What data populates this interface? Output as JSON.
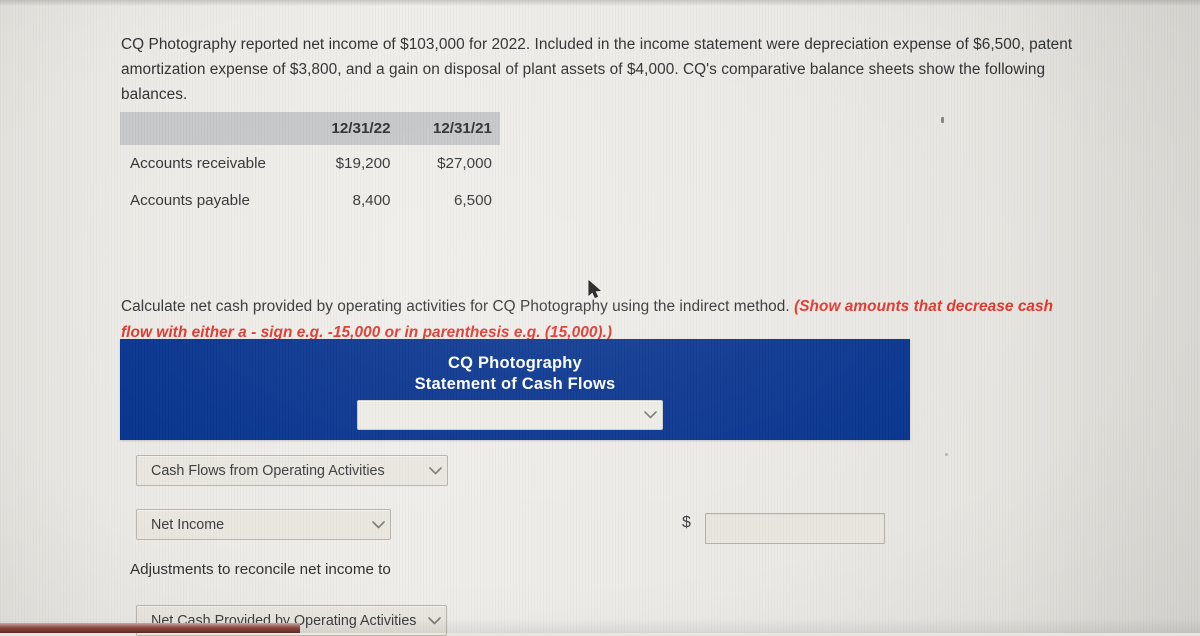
{
  "problem": {
    "intro_text": "CQ Photography reported net income of $103,000 for 2022. Included in the income statement were depreciation expense of $6,500, patent amortization expense of $3,800, and a gain on disposal of plant assets of $4,000. CQ's comparative balance sheets show the following balances.",
    "instruction_text": "Calculate net cash provided by operating activities for CQ Photography using the indirect method. ",
    "instruction_emphasis": "(Show amounts that decrease cash flow with either a - sign e.g. -15,000 or in parenthesis e.g. (15,000).)"
  },
  "balances_table": {
    "columns": [
      "",
      "12/31/22",
      "12/31/21"
    ],
    "rows": [
      {
        "label": "Accounts receivable",
        "col_2022": "$19,200",
        "col_2021": "$27,000"
      },
      {
        "label": "Accounts payable",
        "col_2022": "8,400",
        "col_2021": "6,500"
      }
    ]
  },
  "statement": {
    "company_name": "CQ Photography",
    "title": "Statement of Cash Flows",
    "period_select_value": "",
    "period_select_placeholder": ""
  },
  "form": {
    "section_select_value": "Cash Flows from Operating Activities",
    "line_1_select_value": "Net Income",
    "adjustments_label": "Adjustments to reconcile net income to",
    "line_2_select_value": "Net Cash Provided by Operating Activities",
    "currency_symbol": "$",
    "amount_value": "",
    "amount_placeholder": ""
  },
  "colors": {
    "statement_header_blue": "#04318d",
    "emphasis_red": "#e03228",
    "table_header_gray": "#c5c6c8",
    "page_background": "#ebe9e4"
  },
  "icons": {
    "chevron": "chevron-down-icon",
    "cursor": "mouse-pointer-icon"
  }
}
